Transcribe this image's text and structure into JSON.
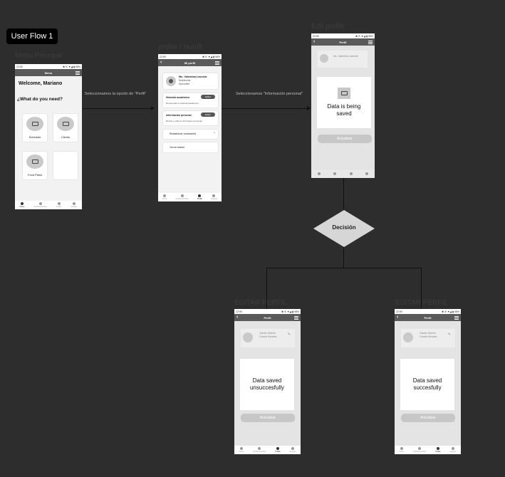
{
  "diagram": {
    "title": "User Flow 1",
    "nodes": [
      {
        "id": "menu",
        "label": "Menu Principal"
      },
      {
        "id": "profile",
        "label": "profile / Nutrifi"
      },
      {
        "id": "edit",
        "label": "Edit profile"
      },
      {
        "id": "decision",
        "label": "Decisión"
      },
      {
        "id": "fail",
        "label": "EDITAR PERFIL"
      },
      {
        "id": "success",
        "label": "EDITAR PERFIL"
      }
    ],
    "edges": [
      {
        "from": "menu",
        "to": "profile",
        "label": "Seleccionamos  la opción de \"Perfil\""
      },
      {
        "from": "profile",
        "to": "edit",
        "label": "Seleccionamos \"Información personal\""
      },
      {
        "from": "edit",
        "to": "decision",
        "label": ""
      },
      {
        "from": "decision",
        "to": "fail",
        "label": ""
      },
      {
        "from": "decision",
        "to": "success",
        "label": ""
      }
    ]
  },
  "status_time": "22:59",
  "status_icons": "✱ ✆ ▼◢ ▮ 98%",
  "tabs": [
    "Home",
    "Nutritional Plans",
    "Profile",
    "Settings"
  ],
  "menu_screen": {
    "bar_title": "Menu",
    "welcome": "Welcome, Mariano",
    "question": "¿What do you need?",
    "cards": [
      "Schedule",
      "Clients",
      "Food Plans",
      ""
    ]
  },
  "profile_screen": {
    "bar_title": "Mi perfil",
    "name": "Ms. Valentina Laverde",
    "subtitle": "Nutritionist",
    "detail": "Specialist",
    "rows": [
      {
        "title": "Historial académico",
        "button": "Editar",
        "desc": "Revisa toda tu historial académico"
      },
      {
        "title": "Información personal",
        "button": "Editar",
        "desc": "Revisa y edita tu información personal"
      },
      {
        "title": "Restablecer contraseña",
        "button": "",
        "desc": ""
      },
      {
        "title": "Cerrar sesión",
        "button": "",
        "desc": ""
      }
    ]
  },
  "edit_screen": {
    "bar_title": "Perfil",
    "user_name": "Ms. Valentina Laverde",
    "modal_text": "Data is being saved",
    "button": "Actualizar"
  },
  "fail_screen": {
    "bar_title": "Perfil",
    "user_name": "Camilo Alberto Cuesta Morales",
    "modal_text": "Data saved unsuccesfully",
    "button": "Actualizar"
  },
  "success_screen": {
    "bar_title": "Perfil",
    "user_name": "Camilo Alberto Cuesta Morales",
    "modal_text": "Data saved succesfully",
    "button": "Actualizar"
  }
}
